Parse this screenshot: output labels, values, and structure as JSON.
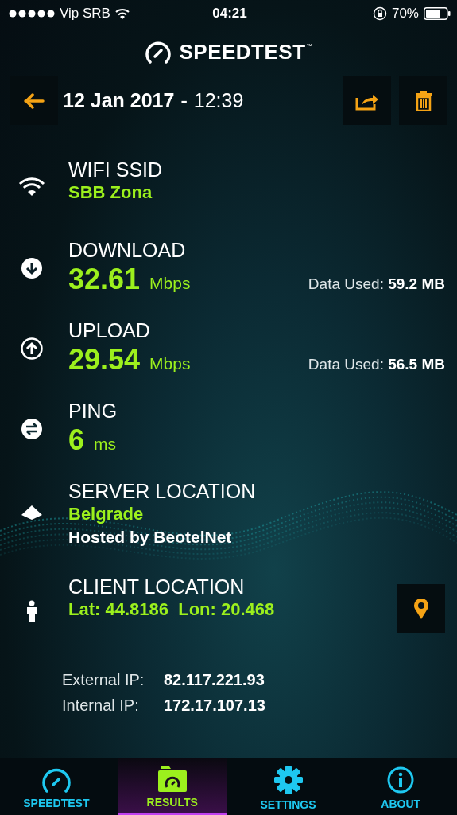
{
  "status_bar": {
    "carrier": "Vip SRB",
    "time": "04:21",
    "battery": "70%"
  },
  "app_title": {
    "name": "SPEEDTEST",
    "mark": "™"
  },
  "header": {
    "date": "12 Jan 2017",
    "separator": "-",
    "time": "12:39"
  },
  "results": [
    {
      "kind": "wifi",
      "label": "WIFI SSID",
      "value": "SBB Zona"
    },
    {
      "kind": "download",
      "label": "DOWNLOAD",
      "value": "32.61",
      "unit": "Mbps",
      "data_used_label": "Data Used:",
      "data_used": "59.2 MB"
    },
    {
      "kind": "upload",
      "label": "UPLOAD",
      "value": "29.54",
      "unit": "Mbps",
      "data_used_label": "Data Used:",
      "data_used": "56.5 MB"
    },
    {
      "kind": "ping",
      "label": "PING",
      "value": "6",
      "unit": "ms"
    },
    {
      "kind": "server",
      "label": "SERVER LOCATION",
      "value": "Belgrade",
      "detail": "Hosted by BeotelNet"
    },
    {
      "kind": "client",
      "label": "CLIENT LOCATION",
      "value": "Lat: 44.8186  Lon: 20.468"
    }
  ],
  "ip": [
    {
      "label": "External IP:",
      "value": "82.117.221.93"
    },
    {
      "label": "Internal IP:",
      "value": "172.17.107.13"
    }
  ],
  "tabs": [
    {
      "kind": "speedtest",
      "label": "SPEEDTEST",
      "selected": false
    },
    {
      "kind": "results",
      "label": "RESULTS",
      "selected": true
    },
    {
      "kind": "settings",
      "label": "SETTINGS",
      "selected": false
    },
    {
      "kind": "about",
      "label": "ABOUT",
      "selected": false
    }
  ]
}
